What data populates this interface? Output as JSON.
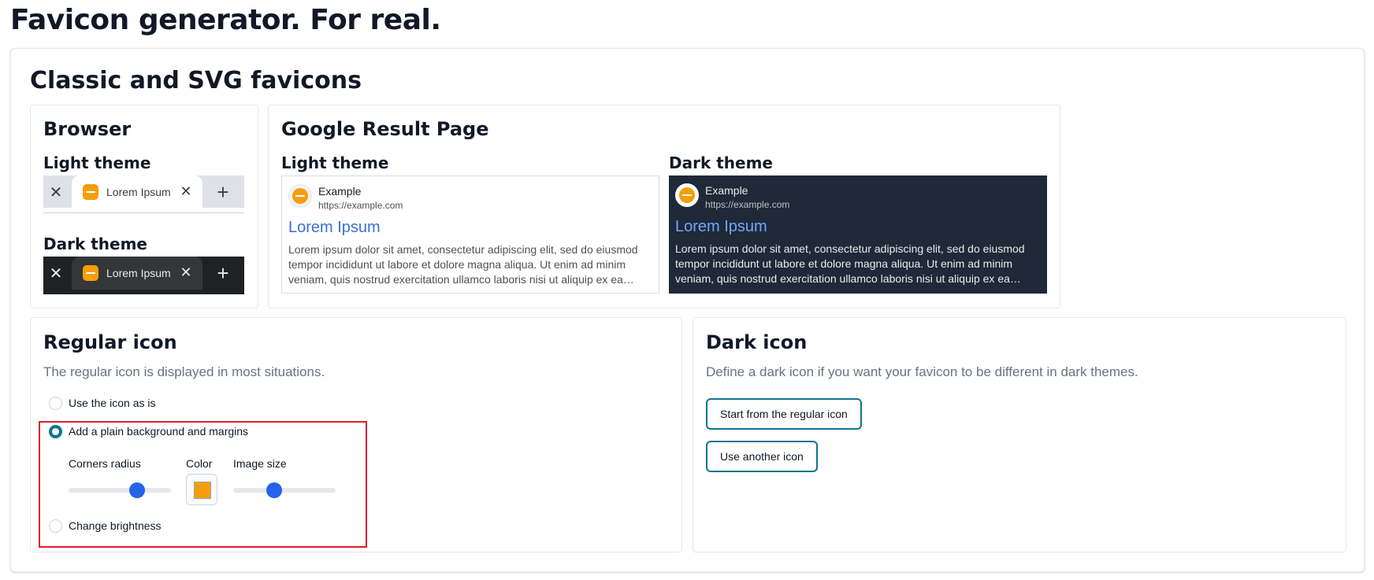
{
  "page": {
    "title": "Favicon generator. For real."
  },
  "section": {
    "title": "Classic and SVG favicons"
  },
  "browser": {
    "title": "Browser",
    "light_label": "Light theme",
    "dark_label": "Dark theme",
    "tab_label": "Lorem Ipsum",
    "close_glyph": "✕",
    "plus_glyph": "+"
  },
  "google": {
    "title": "Google Result Page",
    "light_label": "Light theme",
    "dark_label": "Dark theme",
    "site_name": "Example",
    "site_url": "https://example.com",
    "result_title": "Lorem Ipsum",
    "result_desc": "Lorem ipsum dolor sit amet, consectetur adipiscing elit, sed do eiusmod tempor incididunt ut labore et dolore magna aliqua. Ut enim ad minim veniam, quis nostrud exercitation ullamco laboris nisi ut aliquip ex ea commodo consequat."
  },
  "regular_icon": {
    "title": "Regular icon",
    "description": "The regular icon is displayed in most situations.",
    "options": [
      {
        "label": "Use the icon as is",
        "checked": false
      },
      {
        "label": "Add a plain background and margins",
        "checked": true
      },
      {
        "label": "Change brightness",
        "checked": false
      }
    ],
    "controls": {
      "corners_radius_label": "Corners radius",
      "corners_radius_value": 0.67,
      "color_label": "Color",
      "color_value": "#f59e0b",
      "image_size_label": "Image size",
      "image_size_value": 0.42
    }
  },
  "dark_icon": {
    "title": "Dark icon",
    "description": "Define a dark icon if you want your favicon to be different in dark themes.",
    "start_button": "Start from the regular icon",
    "another_button": "Use another icon"
  },
  "colors": {
    "accent": "#0e7490",
    "favicon": "#f59e0b",
    "slider": "#2563eb",
    "highlight": "#e11d2a"
  }
}
